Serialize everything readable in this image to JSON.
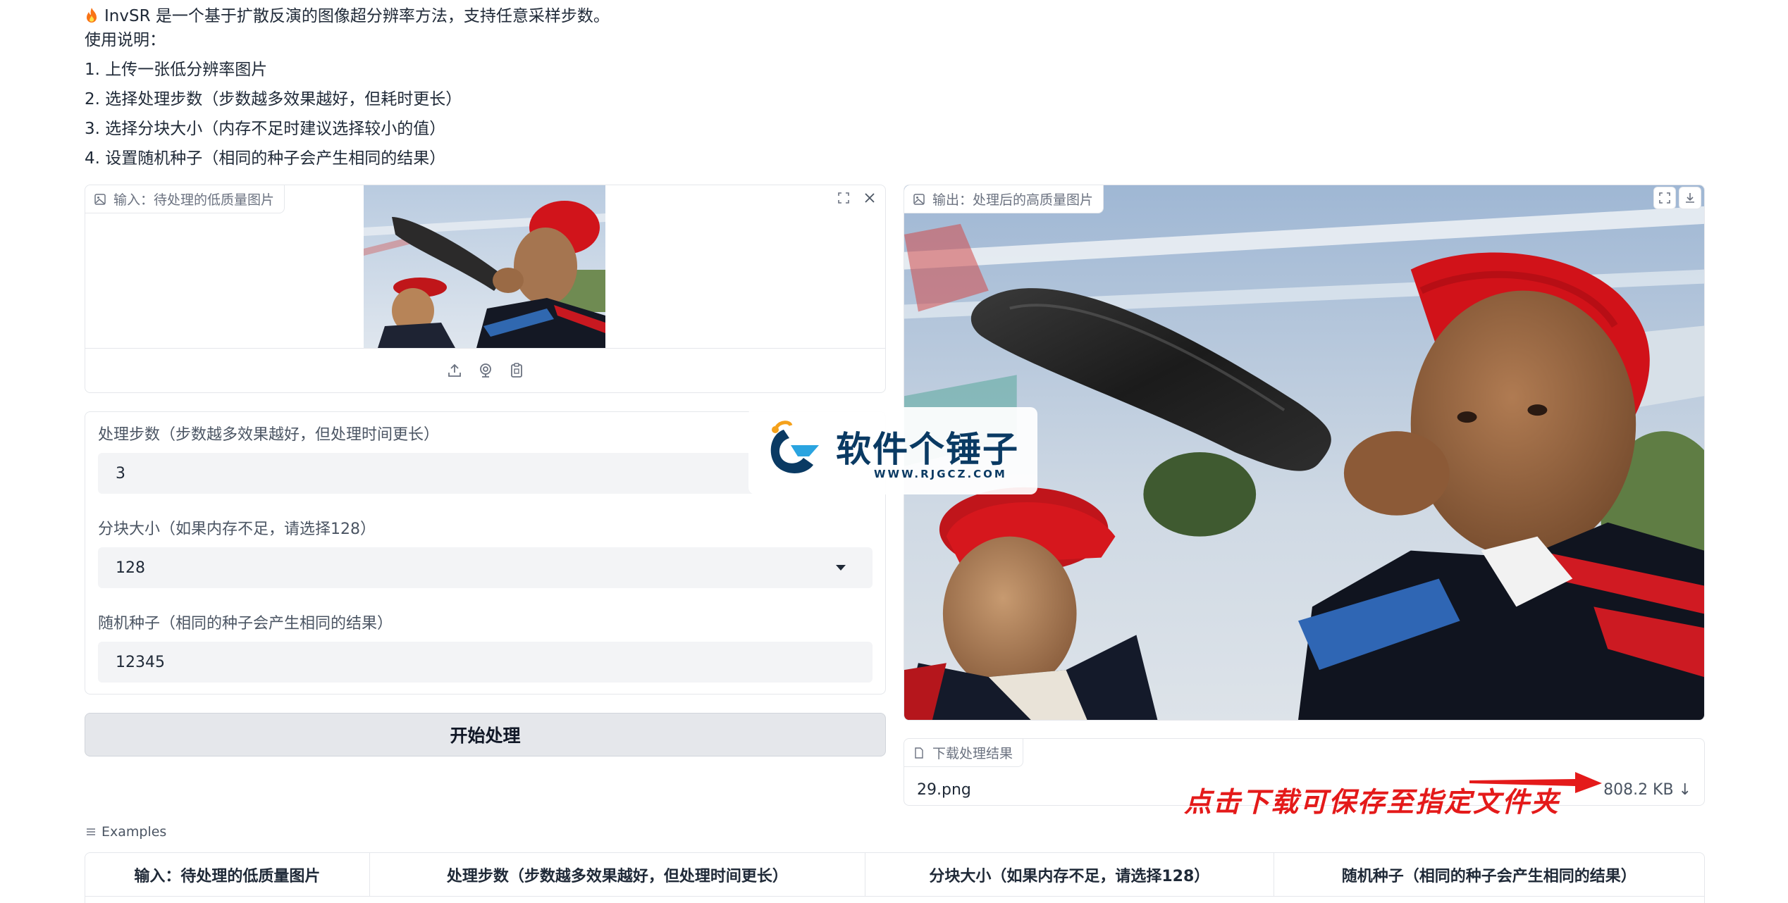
{
  "description": {
    "intro": "InvSR 是一个基于扩散反演的图像超分辨率方法，支持任意采样步数。",
    "usage_heading": "使用说明：",
    "steps": [
      "1. 上传一张低分辨率图片",
      "2. 选择处理步数（步数越多效果越好，但耗时更长）",
      "3. 选择分块大小（内存不足时建议选择较小的值）",
      "4. 设置随机种子（相同的种子会产生相同的结果）"
    ]
  },
  "input_image": {
    "label": "输入：待处理的低质量图片",
    "toolbar_icons": [
      "upload-icon",
      "webcam-icon",
      "clipboard-icon"
    ]
  },
  "controls": {
    "steps": {
      "label": "处理步数（步数越多效果越好，但处理时间更长）",
      "value": "3"
    },
    "chunk": {
      "label": "分块大小（如果内存不足，请选择128）",
      "value": "128"
    },
    "seed": {
      "label": "随机种子（相同的种子会产生相同的结果）",
      "value": "12345"
    }
  },
  "run_button": {
    "label": "开始处理"
  },
  "output_image": {
    "label": "输出：处理后的高质量图片"
  },
  "download": {
    "label": "下载处理结果",
    "file_name": "29.png",
    "file_size": "808.2 KB ↓"
  },
  "annotation": "点击下载可保存至指定文件夹",
  "watermark": {
    "text": "软件个锤子",
    "url": "WWW.RJGCZ.COM"
  },
  "examples": {
    "label": "Examples",
    "headers": [
      "输入：待处理的低质量图片",
      "处理步数（步数越多效果越好，但处理时间更长）",
      "分块大小（如果内存不足，请选择128）",
      "随机种子（相同的种子会产生相同的结果）"
    ]
  },
  "colors": {
    "accent_red": "#e41a1a",
    "watermark_blue": "#0a3a63",
    "field_bg": "#f3f4f6",
    "button_bg": "#e5e7eb"
  }
}
